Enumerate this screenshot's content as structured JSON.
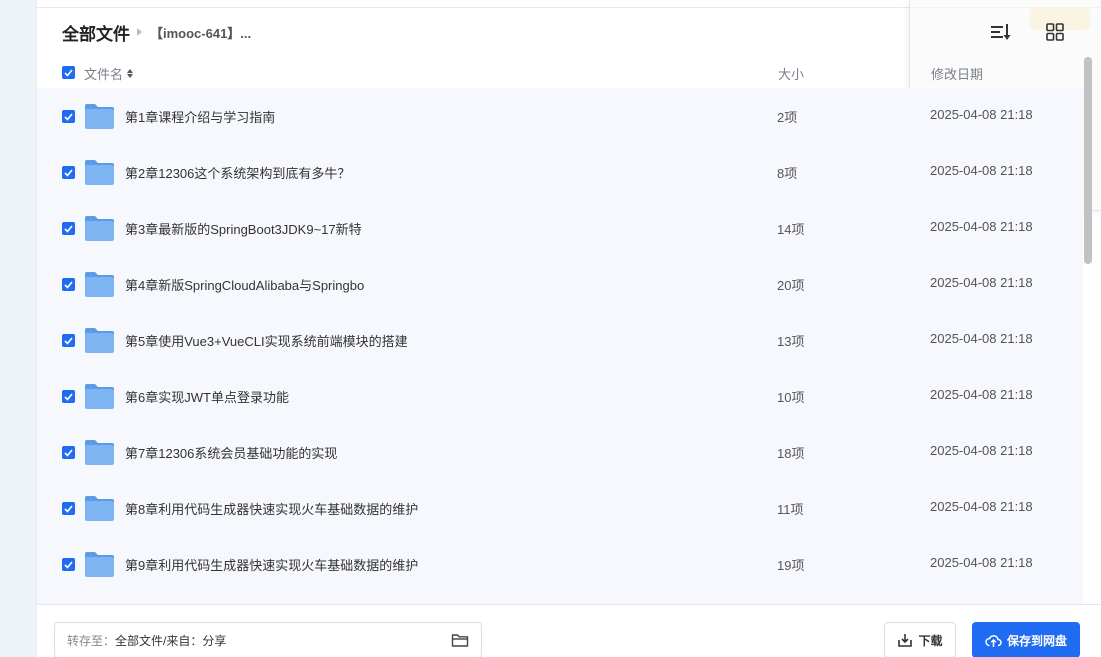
{
  "breadcrumb": {
    "root": "全部文件",
    "current": "【imooc-641】..."
  },
  "columns": {
    "name": "文件名",
    "size": "大小",
    "date": "修改日期"
  },
  "rows": [
    {
      "name": "第1章课程介绍与学习指南",
      "size": "2项",
      "date": "2025-04-08 21:18",
      "checked": true
    },
    {
      "name": "第2章12306这个系统架构到底有多牛？",
      "size": "8项",
      "date": "2025-04-08 21:18",
      "checked": true
    },
    {
      "name": "第3章最新版的SpringBoot3JDK9~17新特",
      "size": "14项",
      "date": "2025-04-08 21:18",
      "checked": true
    },
    {
      "name": "第4章新版SpringCloudAlibaba与Springbo",
      "size": "20项",
      "date": "2025-04-08 21:18",
      "checked": true
    },
    {
      "name": "第5章使用Vue3+VueCLI实现系统前端模块的搭建",
      "size": "13项",
      "date": "2025-04-08 21:18",
      "checked": true
    },
    {
      "name": "第6章实现JWT单点登录功能",
      "size": "10项",
      "date": "2025-04-08 21:18",
      "checked": true
    },
    {
      "name": "第7章12306系统会员基础功能的实现",
      "size": "18项",
      "date": "2025-04-08 21:18",
      "checked": true
    },
    {
      "name": "第8章利用代码生成器快速实现火车基础数据的维护",
      "size": "11项",
      "date": "2025-04-08 21:18",
      "checked": true
    },
    {
      "name": "第9章利用代码生成器快速实现火车基础数据的维护",
      "size": "19项",
      "date": "2025-04-08 21:18",
      "checked": true
    }
  ],
  "footer": {
    "save_to_label": "转存至：",
    "save_to_value": "全部文件/来自：分享",
    "download_label": "下载",
    "save_label": "保存到网盘"
  },
  "icons": {
    "folder": "folder-icon",
    "list_view": "list-view-icon",
    "grid_view": "grid-view-icon",
    "download": "download-icon",
    "cloud_upload": "cloud-upload-icon"
  },
  "colors": {
    "accent": "#1f6bf2",
    "folder": "#6aa7ee",
    "row_bg": "#f6f8fe"
  }
}
